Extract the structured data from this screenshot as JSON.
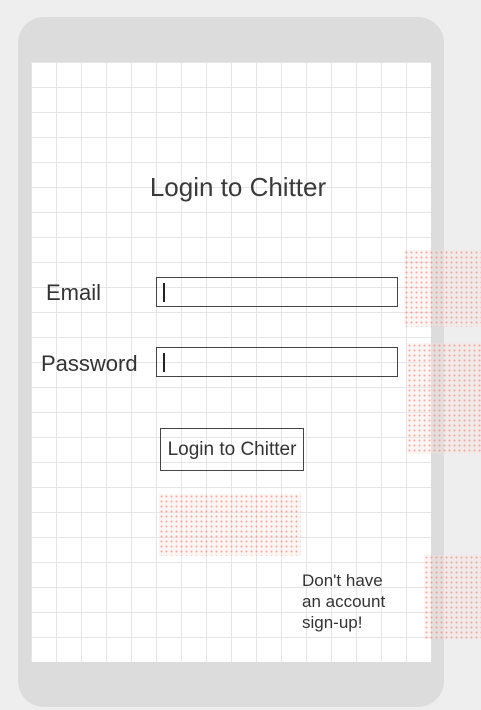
{
  "login": {
    "title": "Login to Chitter",
    "email_label": "Email",
    "email_value": "",
    "password_label": "Password",
    "password_value": "",
    "submit_label": "Login to Chitter",
    "signup_lines": [
      "Don't have",
      "an account",
      "sign-up!"
    ]
  }
}
